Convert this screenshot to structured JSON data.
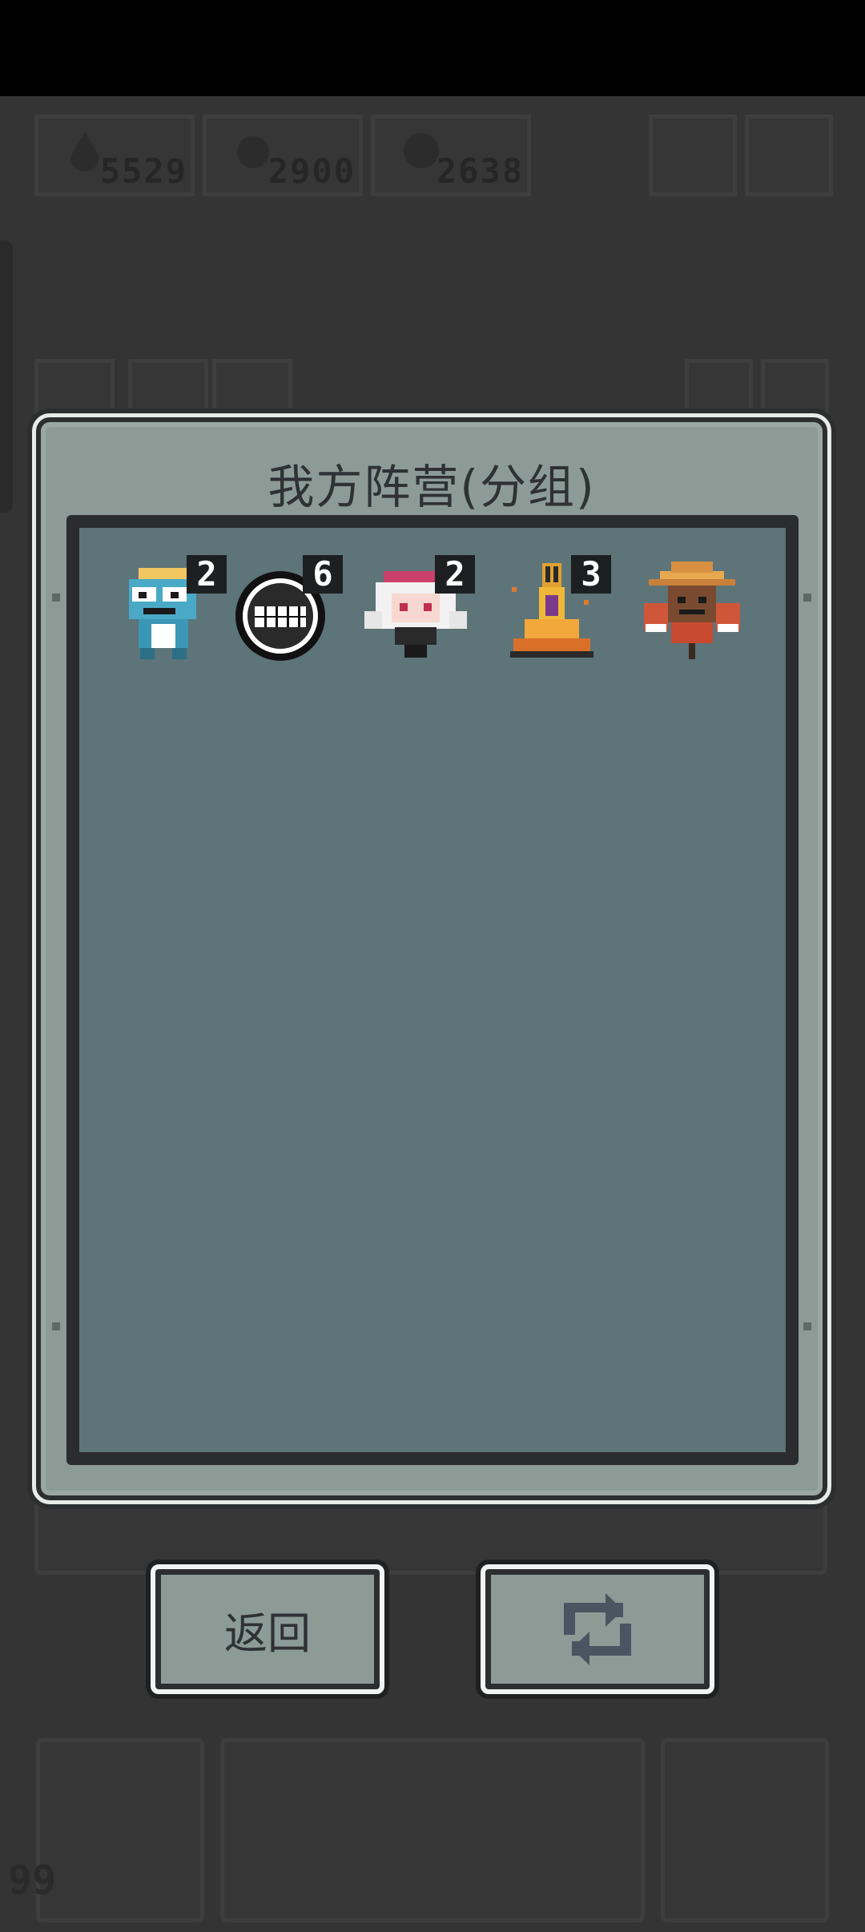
{
  "resources": [
    {
      "icon": "drop-icon",
      "value": "5529"
    },
    {
      "icon": "gear-icon",
      "value": "2900"
    },
    {
      "icon": "skull-icon",
      "value": "2638"
    }
  ],
  "dialog": {
    "title": "我方阵营(分组)",
    "units": [
      {
        "name": "blue-goblin-scientist",
        "count": "2"
      },
      {
        "name": "grinning-bomb",
        "count": "6"
      },
      {
        "name": "white-haired-girl",
        "count": "2"
      },
      {
        "name": "flame-totem",
        "count": "3"
      },
      {
        "name": "scarecrow",
        "count": ""
      }
    ]
  },
  "buttons": {
    "back_label": "返回",
    "swap_icon": "swap-arrows-icon"
  },
  "bottom_bar": {
    "count": "99"
  }
}
